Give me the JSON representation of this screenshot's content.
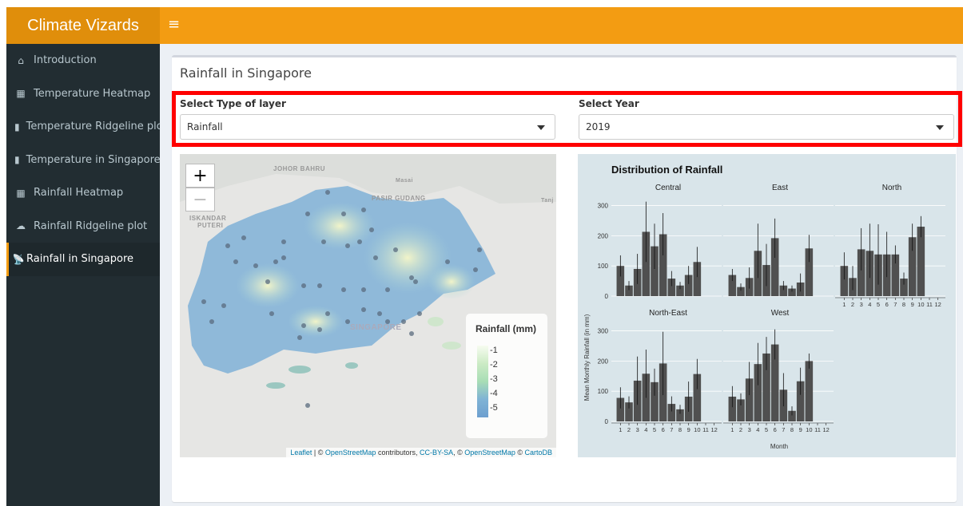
{
  "app": {
    "title": "Climate Vizards",
    "menu_icon": "≡"
  },
  "sidebar": {
    "items": [
      {
        "icon": "home-icon",
        "glyph": "⌂",
        "label": "Introduction",
        "active": false
      },
      {
        "icon": "calendar-icon",
        "glyph": "▦",
        "label": "Temperature Heatmap",
        "active": false
      },
      {
        "icon": "thermometer-icon",
        "glyph": "▮",
        "label": "Temperature Ridgeline plot",
        "active": false
      },
      {
        "icon": "thermometer-icon",
        "glyph": "▮",
        "label": "Temperature in Singapore",
        "active": false
      },
      {
        "icon": "calendar-icon",
        "glyph": "▦",
        "label": "Rainfall Heatmap",
        "active": false
      },
      {
        "icon": "cloud-icon",
        "glyph": "☁",
        "label": "Rainfall Ridgeline plot",
        "active": false
      },
      {
        "icon": "signal-icon",
        "glyph": "📡",
        "label": "Rainfall in Singapore",
        "active": true
      }
    ]
  },
  "page": {
    "title": "Rainfall in Singapore"
  },
  "controls": {
    "layer": {
      "label": "Select Type of layer",
      "value": "Rainfall"
    },
    "year": {
      "label": "Select Year",
      "value": "2019"
    }
  },
  "map": {
    "zoom_in": "+",
    "zoom_out": "−",
    "places": [
      "JOHOR BAHRU",
      "Masai",
      "PASIR GUDANG",
      "ISKANDAR",
      "PUTERI",
      "SINGAPORE",
      "Tanj"
    ],
    "legend": {
      "title": "Rainfall (mm)",
      "ticks": [
        "1",
        "2",
        "3",
        "4",
        "5"
      ]
    },
    "attribution": {
      "leaflet": "Leaflet",
      "sep1": " | © ",
      "osm": "OpenStreetMap",
      "contributors": " contributors, ",
      "license": "CC-BY-SA",
      "sep2": ", © ",
      "osm2": "OpenStreetMap",
      "sep3": " © ",
      "carto": "CartoDB"
    }
  },
  "chart_data": {
    "type": "bar",
    "title": "Distribution of Rainfall",
    "ylabel": "Mean Monthly Rainfall (in mm)",
    "xlabel": "Month",
    "ylim": [
      0,
      320
    ],
    "yticks": [
      0,
      100,
      200,
      300
    ],
    "categories": [
      "1",
      "2",
      "3",
      "4",
      "5",
      "6",
      "7",
      "8",
      "9",
      "10",
      "11",
      "12"
    ],
    "facets": [
      {
        "name": "Central",
        "values": [
          100,
          35,
          90,
          213,
          165,
          205,
          58,
          35,
          70,
          113,
          null,
          null
        ],
        "err": [
          35,
          15,
          50,
          100,
          75,
          70,
          25,
          12,
          30,
          50,
          0,
          0
        ]
      },
      {
        "name": "East",
        "values": [
          70,
          30,
          60,
          150,
          103,
          192,
          35,
          25,
          45,
          158,
          null,
          null
        ],
        "err": [
          20,
          12,
          35,
          90,
          70,
          65,
          15,
          10,
          30,
          45,
          0,
          0
        ]
      },
      {
        "name": "North",
        "values": [
          100,
          60,
          155,
          150,
          138,
          138,
          138,
          58,
          195,
          230,
          null,
          null
        ],
        "err": [
          45,
          40,
          70,
          90,
          100,
          75,
          30,
          20,
          45,
          35,
          0,
          0
        ]
      },
      {
        "name": "North-East",
        "values": [
          78,
          63,
          135,
          158,
          130,
          192,
          58,
          40,
          82,
          157,
          null,
          null
        ],
        "err": [
          35,
          20,
          80,
          80,
          45,
          105,
          25,
          15,
          50,
          50,
          0,
          0
        ]
      },
      {
        "name": "West",
        "values": [
          82,
          73,
          142,
          190,
          225,
          255,
          105,
          35,
          133,
          200,
          null,
          null
        ],
        "err": [
          35,
          20,
          55,
          70,
          55,
          50,
          55,
          15,
          45,
          25,
          0,
          0
        ]
      }
    ],
    "colors": {
      "bar": "#505050",
      "panel": "#d9e5ea",
      "grid": "#ffffff"
    }
  }
}
